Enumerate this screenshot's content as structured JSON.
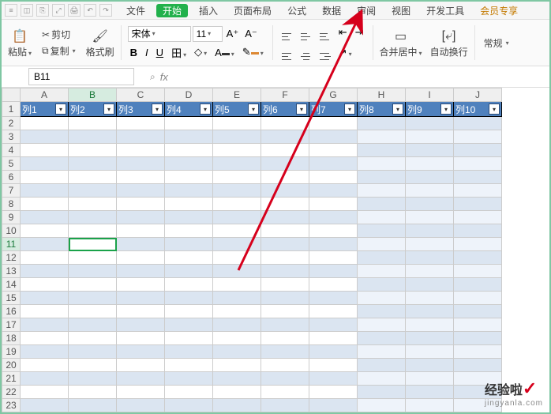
{
  "menubar": {
    "file": "文件",
    "tabs": [
      "开始",
      "插入",
      "页面布局",
      "公式",
      "数据",
      "审阅",
      "视图",
      "开发工具",
      "会员专享"
    ],
    "active_index": 0,
    "quick_icons": [
      "≡",
      "◫",
      "⎘",
      "⤢",
      "🖨",
      "↶",
      "↷"
    ]
  },
  "ribbon": {
    "paste": "粘贴",
    "cut": "剪切",
    "copy": "复制",
    "format_painter": "格式刷",
    "font_name": "宋体",
    "font_size": "11",
    "bold": "B",
    "italic": "I",
    "underline": "U",
    "border": "田",
    "merge_label": "合并居中",
    "wrap_label": "自动换行",
    "regular_label": "常规"
  },
  "formula_row": {
    "namebox_value": "B11",
    "fx_label": "fx",
    "search_icon": "⌕"
  },
  "grid": {
    "columns": [
      "A",
      "B",
      "C",
      "D",
      "E",
      "F",
      "G",
      "H",
      "I",
      "J"
    ],
    "row_count": 23,
    "header_labels": [
      "列1",
      "列2",
      "列3",
      "列4",
      "列5",
      "列6",
      "列7",
      "列8",
      "列9",
      "列10"
    ],
    "selected_cell": {
      "col": "B",
      "row": 11
    }
  },
  "watermark": {
    "text": "经验啦",
    "tick": "✓",
    "url": "jingyanla.com"
  }
}
